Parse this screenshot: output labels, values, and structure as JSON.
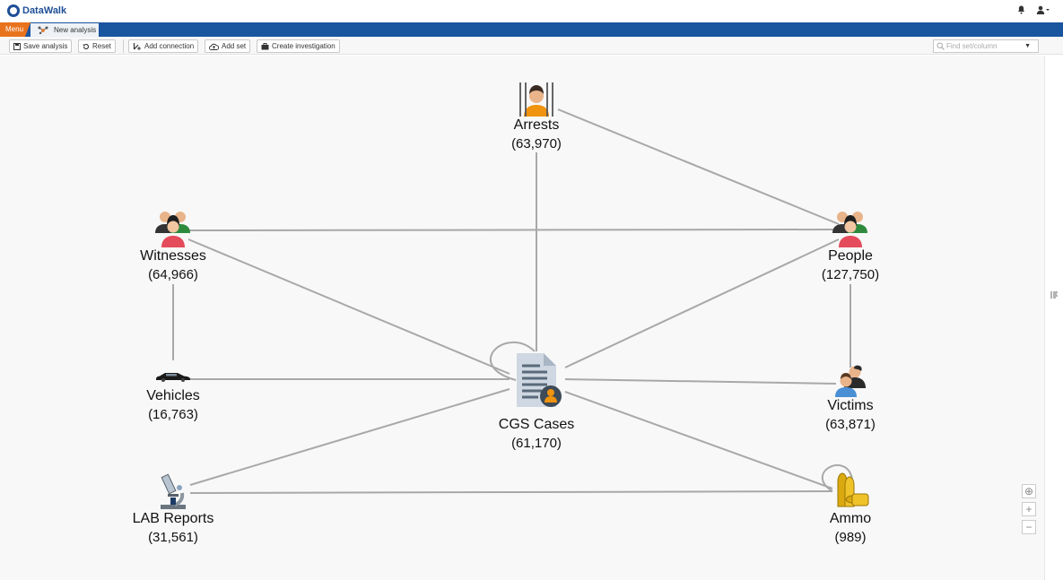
{
  "app": {
    "name": "DataWalk"
  },
  "tabs": {
    "menu": "Menu",
    "active": "New analysis"
  },
  "toolbar": {
    "save": "Save analysis",
    "reset": "Reset",
    "add_connection": "Add connection",
    "add_set": "Add set",
    "create_investigation": "Create investigation"
  },
  "search": {
    "placeholder": "Find set/column"
  },
  "nodes": {
    "arrests": {
      "label": "Arrests",
      "count": "(63,970)",
      "icon": "prisoner-icon"
    },
    "witnesses": {
      "label": "Witnesses",
      "count": "(64,966)",
      "icon": "people-group-icon"
    },
    "people": {
      "label": "People",
      "count": "(127,750)",
      "icon": "people-group-icon"
    },
    "vehicles": {
      "label": "Vehicles",
      "count": "(16,763)",
      "icon": "car-icon"
    },
    "cgs_cases": {
      "label": "CGS Cases",
      "count": "(61,170)",
      "icon": "case-document-icon"
    },
    "victims": {
      "label": "Victims",
      "count": "(63,871)",
      "icon": "victims-icon"
    },
    "lab_reports": {
      "label": "LAB Reports",
      "count": "(31,561)",
      "icon": "microscope-icon"
    },
    "ammo": {
      "label": "Ammo",
      "count": "(989)",
      "icon": "ammo-icon"
    }
  },
  "zoom": {
    "recenter": "⊕",
    "in": "+",
    "out": "−"
  },
  "colors": {
    "brand": "#1f4e96",
    "tab_bar": "#1a55a0",
    "menu_tab": "#e8731d",
    "edge": "#a8a8a8"
  }
}
